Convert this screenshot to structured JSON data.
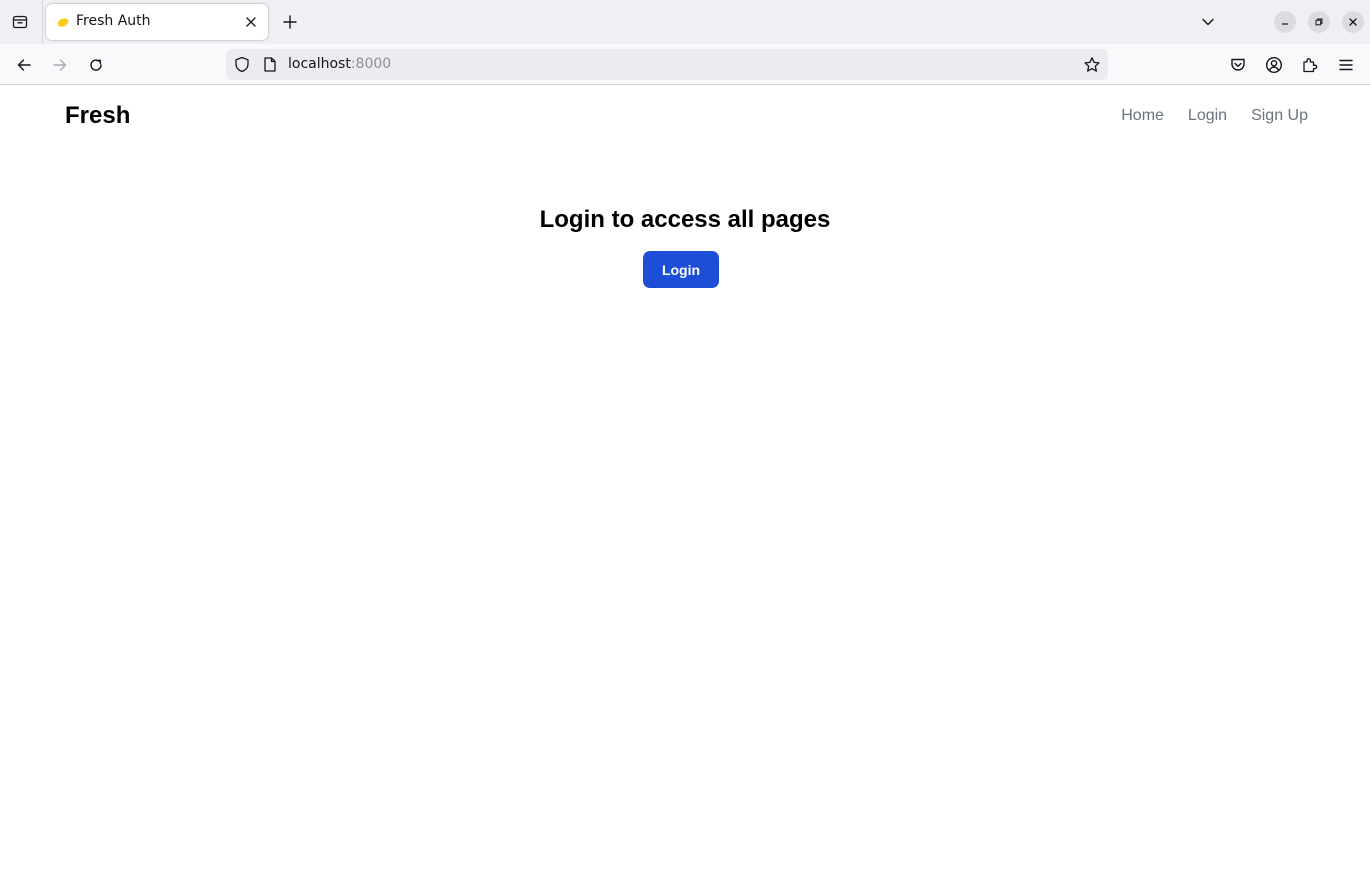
{
  "browser": {
    "tab": {
      "title": "Fresh Auth"
    },
    "url": {
      "host": "localhost",
      "port": ":8000"
    },
    "colors": {
      "favicon": "#facc15",
      "accent_button": "#1d4ed8"
    }
  },
  "site": {
    "brand": "Fresh",
    "nav": {
      "home": "Home",
      "login": "Login",
      "signup": "Sign Up"
    }
  },
  "main": {
    "heading": "Login to access all pages",
    "login_button": "Login"
  }
}
